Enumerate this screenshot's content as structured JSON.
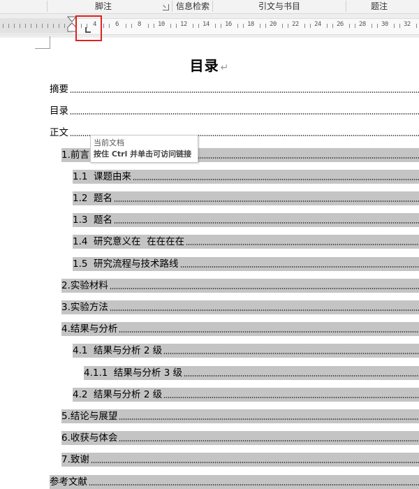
{
  "ribbon": {
    "groups": {
      "footnote": "脚注",
      "research": "信息检索",
      "citations": "引文与书目",
      "captions": "题注"
    }
  },
  "ruler": {
    "numbers": [
      "4",
      "6",
      "8",
      "10",
      "12",
      "14",
      "16",
      "18",
      "20",
      "22",
      "24",
      "26",
      "28",
      "30",
      "32"
    ]
  },
  "document": {
    "title": "目录",
    "paragraph_mark": "↵",
    "toc": [
      {
        "text": "摘要",
        "level": 0,
        "shaded": false
      },
      {
        "text": "目录",
        "level": 0,
        "shaded": false
      },
      {
        "text": "正文",
        "level": 0,
        "shaded": false
      },
      {
        "text": "1.前言",
        "level": 1,
        "shaded": true
      },
      {
        "text": "1.1  课题由来",
        "level": 2,
        "shaded": true
      },
      {
        "text": "1.2  题名",
        "level": 2,
        "shaded": true
      },
      {
        "text": "1.3  题名",
        "level": 2,
        "shaded": true
      },
      {
        "text": "1.4  研究意义在  在在在在",
        "level": 2,
        "shaded": true
      },
      {
        "text": "1.5  研究流程与技术路线",
        "level": 2,
        "shaded": true
      },
      {
        "text": "2.实验材料",
        "level": 1,
        "shaded": true
      },
      {
        "text": "3.实验方法",
        "level": 1,
        "shaded": true
      },
      {
        "text": "4.结果与分析",
        "level": 1,
        "shaded": true
      },
      {
        "text": "4.1  结果与分析 2 级",
        "level": 2,
        "shaded": true
      },
      {
        "text": "4.1.1  结果与分析 3 级",
        "level": 3,
        "shaded": true
      },
      {
        "text": "4.2  结果与分析 2 级",
        "level": 2,
        "shaded": true
      },
      {
        "text": "5.结论与展望",
        "level": 1,
        "shaded": true
      },
      {
        "text": "6.收获与体会",
        "level": 1,
        "shaded": true
      },
      {
        "text": "7.致谢",
        "level": 1,
        "shaded": true
      },
      {
        "text": "参考文献",
        "level": 0,
        "shaded": true
      }
    ]
  },
  "tooltip": {
    "title": "当前文档",
    "hint": "按住 Ctrl 并单击可访问链接"
  },
  "colors": {
    "field_shading": "#c4c4c4",
    "highlight_box": "#e02020"
  }
}
